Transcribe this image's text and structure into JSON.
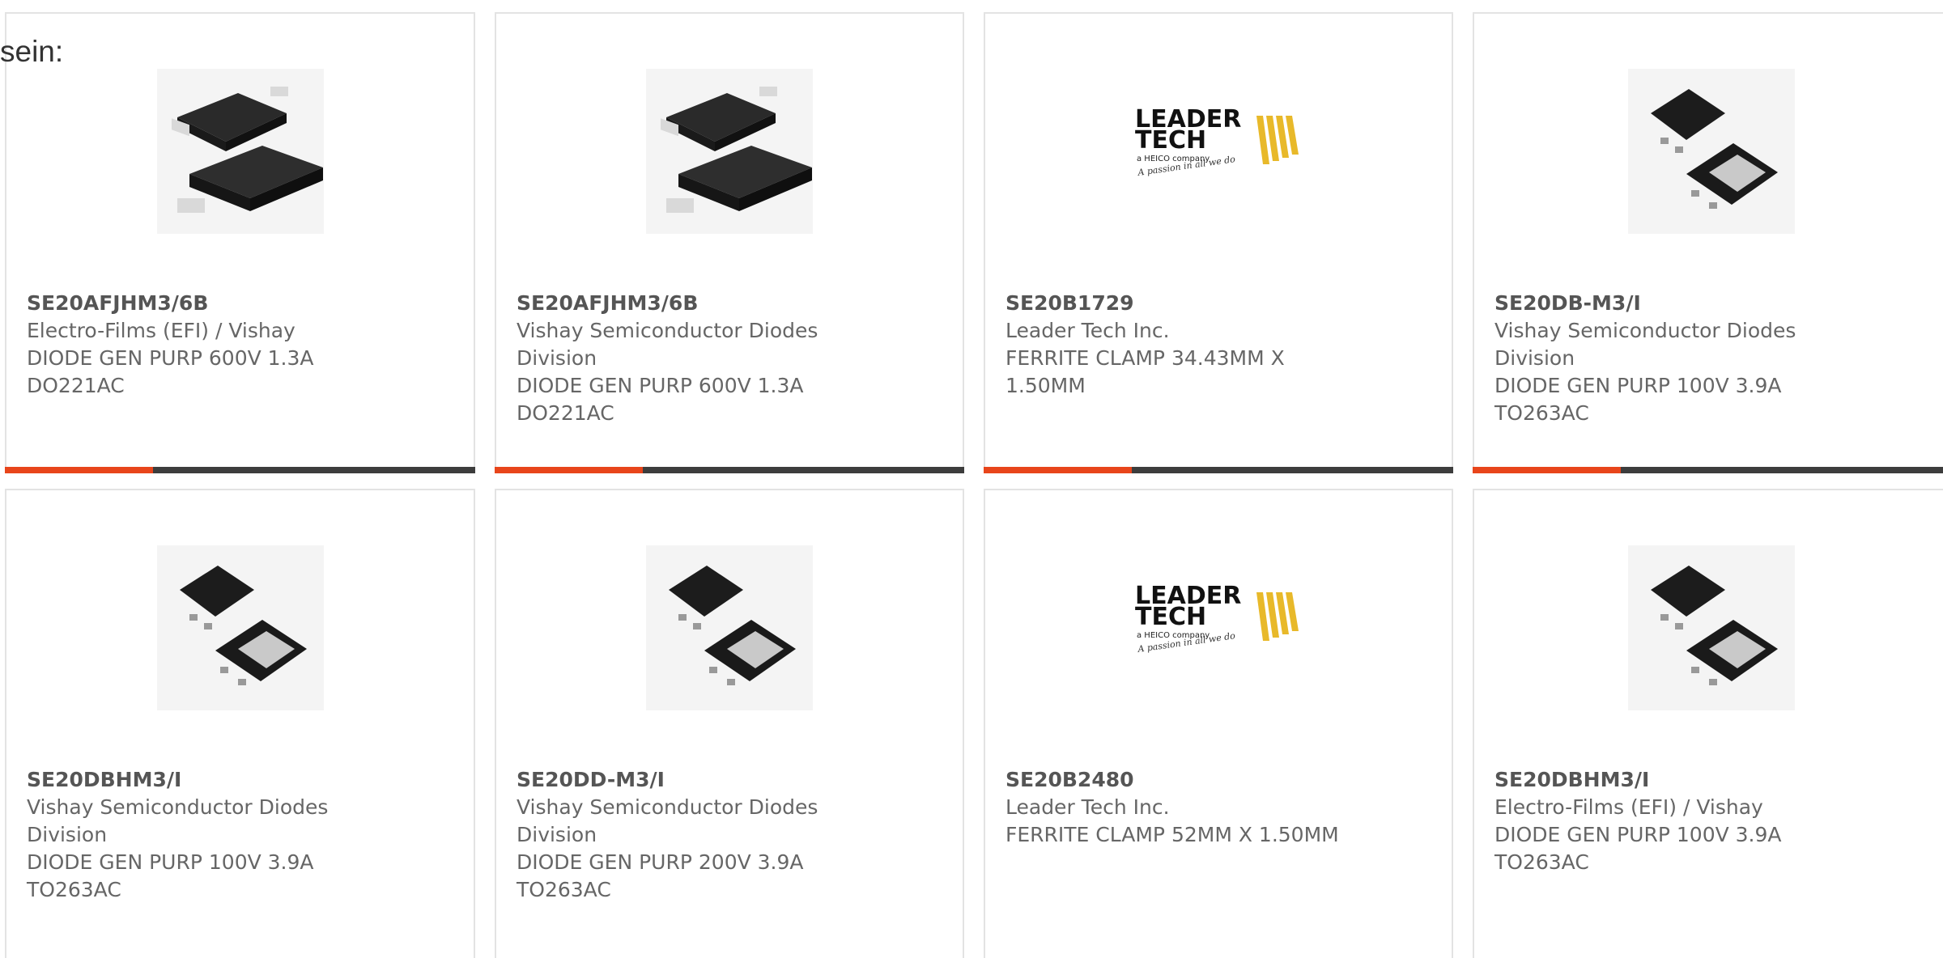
{
  "intro_text": "sein:",
  "colors": {
    "accent": "#e8451b",
    "bar": "#3d3d3d",
    "card_border": "#e3e3e3",
    "text": "#666666"
  },
  "products": [
    {
      "part_number": "SE20AFJHM3/6B",
      "manufacturer": "Electro-Films (EFI) / Vishay",
      "description": "DIODE GEN PURP 600V 1.3A DO221AC",
      "image": "smd-diode-package-image"
    },
    {
      "part_number": "SE20AFJHM3/6B",
      "manufacturer": "Vishay Semiconductor Diodes Division",
      "description": "DIODE GEN PURP 600V 1.3A DO221AC",
      "image": "smd-diode-package-image"
    },
    {
      "part_number": "SE20B1729",
      "manufacturer": "Leader Tech Inc.",
      "description": "FERRITE CLAMP 34.43MM X 1.50MM",
      "image": "leader-tech-logo"
    },
    {
      "part_number": "SE20DB-M3/I",
      "manufacturer": "Vishay Semiconductor Diodes Division",
      "description": "DIODE GEN PURP 100V 3.9A TO263AC",
      "image": "to263-package-image"
    },
    {
      "part_number": "SE20DBHM3/I",
      "manufacturer": "Vishay Semiconductor Diodes Division",
      "description": "DIODE GEN PURP 100V 3.9A TO263AC",
      "image": "to263-package-image"
    },
    {
      "part_number": "SE20DD-M3/I",
      "manufacturer": "Vishay Semiconductor Diodes Division",
      "description": "DIODE GEN PURP 200V 3.9A TO263AC",
      "image": "to263-package-image"
    },
    {
      "part_number": "SE20B2480",
      "manufacturer": "Leader Tech Inc.",
      "description": "FERRITE CLAMP 52MM X 1.50MM",
      "image": "leader-tech-logo"
    },
    {
      "part_number": "SE20DBHM3/I",
      "manufacturer": "Electro-Films (EFI) / Vishay",
      "description": "DIODE GEN PURP 100V 3.9A TO263AC",
      "image": "to263-package-image"
    }
  ],
  "logo": {
    "line1": "LEADER",
    "line2": "TECH",
    "line3": "a HEICO company",
    "tagline": "A passion in all we do"
  }
}
